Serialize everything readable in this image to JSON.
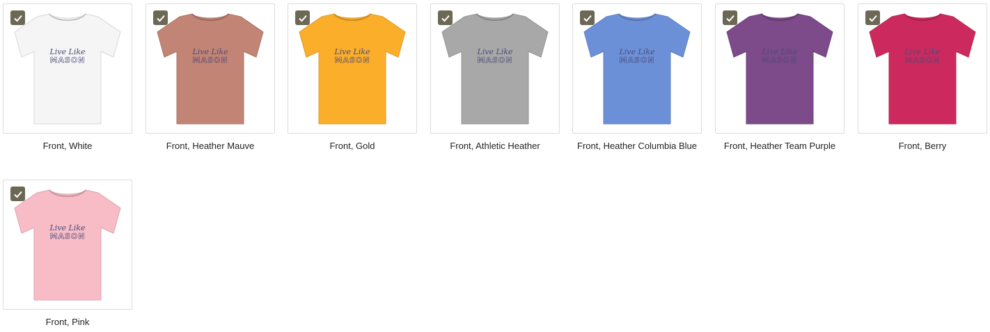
{
  "variants": [
    {
      "label": "Front, White",
      "color": "#f5f5f5",
      "checked": true
    },
    {
      "label": "Front, Heather Mauve",
      "color": "#c28474",
      "checked": true
    },
    {
      "label": "Front, Gold",
      "color": "#fbae2a",
      "checked": true
    },
    {
      "label": "Front, Athletic Heather",
      "color": "#a8a8a8",
      "checked": true
    },
    {
      "label": "Front, Heather Columbia Blue",
      "color": "#6c90d8",
      "checked": true
    },
    {
      "label": "Front, Heather Team Purple",
      "color": "#7d4a8a",
      "checked": true
    },
    {
      "label": "Front, Berry",
      "color": "#cc2a5f",
      "checked": true
    },
    {
      "label": "Front, Pink",
      "color": "#f7bcc6",
      "checked": true
    }
  ],
  "design": {
    "line1": "Live Like",
    "line2": "MASON"
  },
  "icons": {
    "check": "checkmark-icon"
  }
}
